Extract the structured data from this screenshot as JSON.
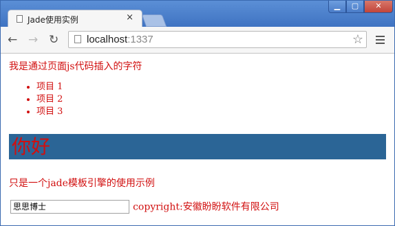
{
  "browser": {
    "tab_title": "Jade使用实例",
    "tab_close": "×",
    "url_host": "localhost",
    "url_port": ":1337"
  },
  "page": {
    "intro": "我是通过页面js代码插入的字符",
    "list_items": [
      "项目 1",
      "项目 2",
      "项目 3"
    ],
    "banner": "你好",
    "description": "只是一个jade模板引擎的使用示例",
    "name_input_value": "思思博士",
    "copyright": "copyright:安徽盼盼软件有限公司"
  },
  "colors": {
    "text_red": "#d10f0f",
    "banner_bg": "#2b6596",
    "titlebar": "#4a7cc8"
  },
  "icons": [
    "document-icon",
    "back-arrow-icon",
    "forward-arrow-icon",
    "reload-icon",
    "star-icon",
    "menu-icon",
    "minimize-icon",
    "maximize-icon",
    "close-icon"
  ]
}
